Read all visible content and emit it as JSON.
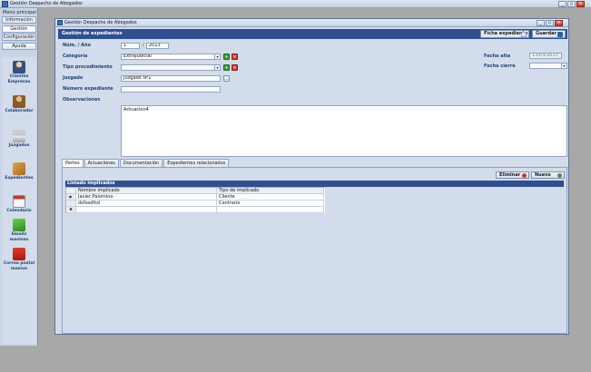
{
  "app": {
    "title": "Gestión Despacho de Abogados"
  },
  "window_controls": {
    "minimize": "_",
    "restore": "▫",
    "close": "×"
  },
  "left_menu": {
    "menu_label": "Menú principal",
    "tabs": [
      "Información",
      "Gestión",
      "Configuración",
      "Ayuda"
    ],
    "nav_items": [
      {
        "label": "Clientes Empresas",
        "icon": "people-icon"
      },
      {
        "label": "Colaborador",
        "icon": "collaborator-icon"
      },
      {
        "label": "Juzgados",
        "icon": "courthouse-icon"
      },
      {
        "label": "Expedientes",
        "icon": "box-icon"
      },
      {
        "label": "Calendario",
        "icon": "calendar-icon"
      },
      {
        "label": "Emails masivos",
        "icon": "email-icon"
      },
      {
        "label": "Correo postal masivo",
        "icon": "mailbox-icon"
      }
    ]
  },
  "inner_window": {
    "title": "Gestión Despacho de Abogados"
  },
  "header": {
    "title": "Gestión de expedientes",
    "ficha_label": "Ficha expediente",
    "guardar_label": "Guardar"
  },
  "form": {
    "num_anio_label": "Núm. / Año",
    "num_value": "1",
    "slash": "/",
    "anio_value": "2013",
    "categoria_label": "Categoría",
    "categoria_value": "Extrajudicial",
    "tipo_label": "Tipo procedimiento",
    "tipo_value": "",
    "juzgado_label": "Juzgado",
    "juzgado_value": "Juzgado Nº1",
    "numero_exp_label": "Número expediente",
    "numero_exp_value": "",
    "observaciones_label": "Observaciones",
    "observaciones_value": "Actuacion4",
    "fecha_alta_label": "Fecha alta",
    "fecha_alta_value": "13/03/2013",
    "fecha_cierre_label": "Fecha cierre",
    "fecha_cierre_value": ""
  },
  "tabs": [
    "Partes",
    "Actuaciones",
    "Documentación",
    "Expedientes relacionados"
  ],
  "partes": {
    "eliminar_label": "Eliminar",
    "nuevo_label": "Nuevo",
    "grid_title": "Listado implicados",
    "columns": [
      "Nombre implicado",
      "Tipo de implicado"
    ],
    "rows": [
      {
        "marker": "▶",
        "nombre": "Javier Palomino",
        "tipo": "Cliente"
      },
      {
        "marker": "",
        "nombre": "dsfsadfsd",
        "tipo": "Contrario"
      }
    ],
    "new_row_marker": "✱"
  },
  "colors": {
    "header_blue": "#2f4f8f",
    "panel_bg": "#d3dcea",
    "mdi_bg": "#a8a8a8",
    "label_blue": "#1f3f7a"
  }
}
